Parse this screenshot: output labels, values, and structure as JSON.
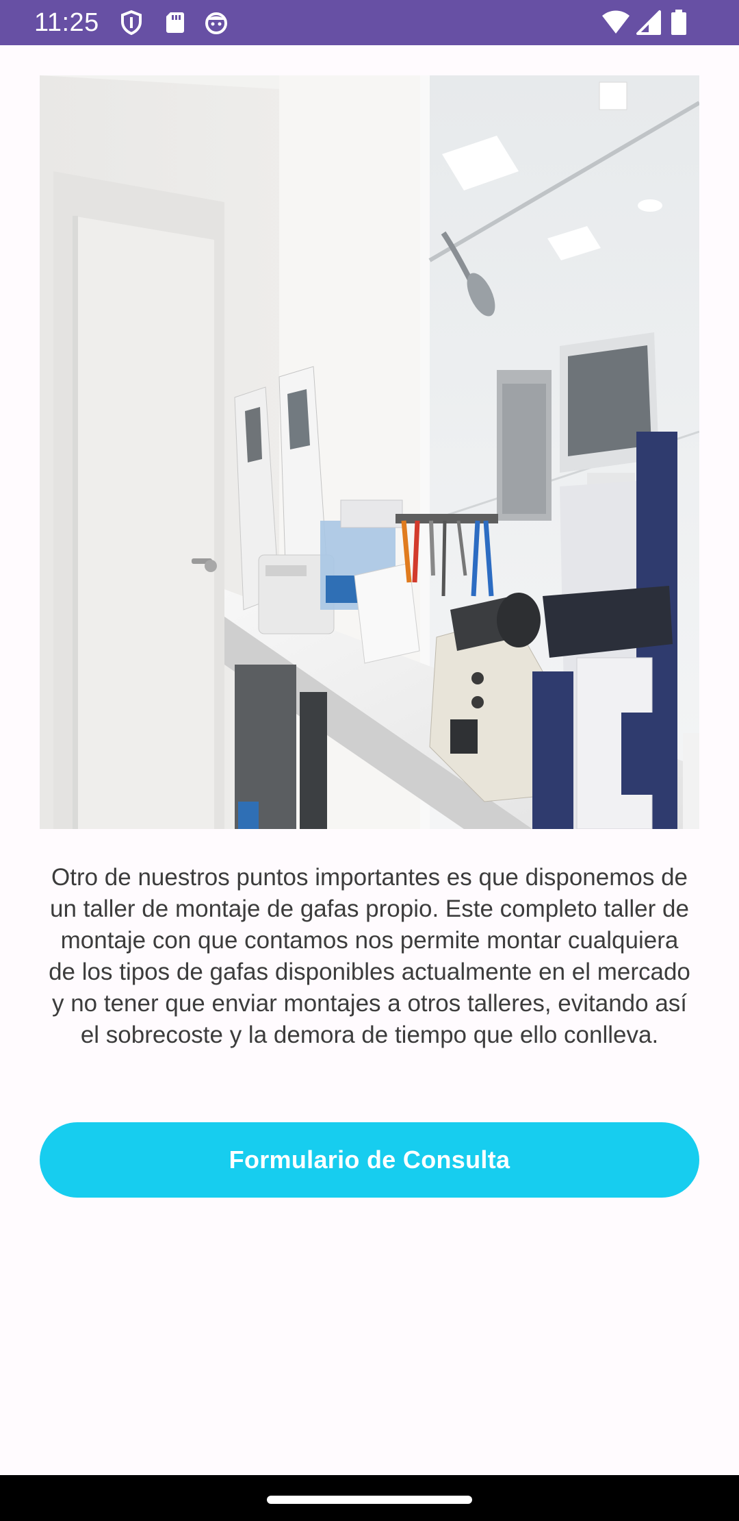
{
  "status_bar": {
    "time": "11:25",
    "left_icons": [
      "shield-icon",
      "sd-card-icon",
      "robot-face-icon"
    ],
    "right_icons": [
      "wifi-icon",
      "cellular-signal-icon",
      "battery-icon"
    ],
    "background": "#6750a4"
  },
  "hero_image": {
    "alt": "Taller de montaje de gafas",
    "icon": "workshop-photo"
  },
  "description": "Otro de nuestros puntos importantes es que disponemos de un taller de montaje de gafas propio. Este completo taller de montaje con que contamos nos permite montar cualquiera de los tipos de gafas disponibles actualmente en el mercado y no tener que enviar montajes a otros talleres, evitando así el sobrecoste y la demora de tiempo que ello conlleva.",
  "cta": {
    "label": "Formulario de Consulta",
    "color": "#17cdef"
  },
  "nav_bar": {
    "background": "#000000"
  }
}
